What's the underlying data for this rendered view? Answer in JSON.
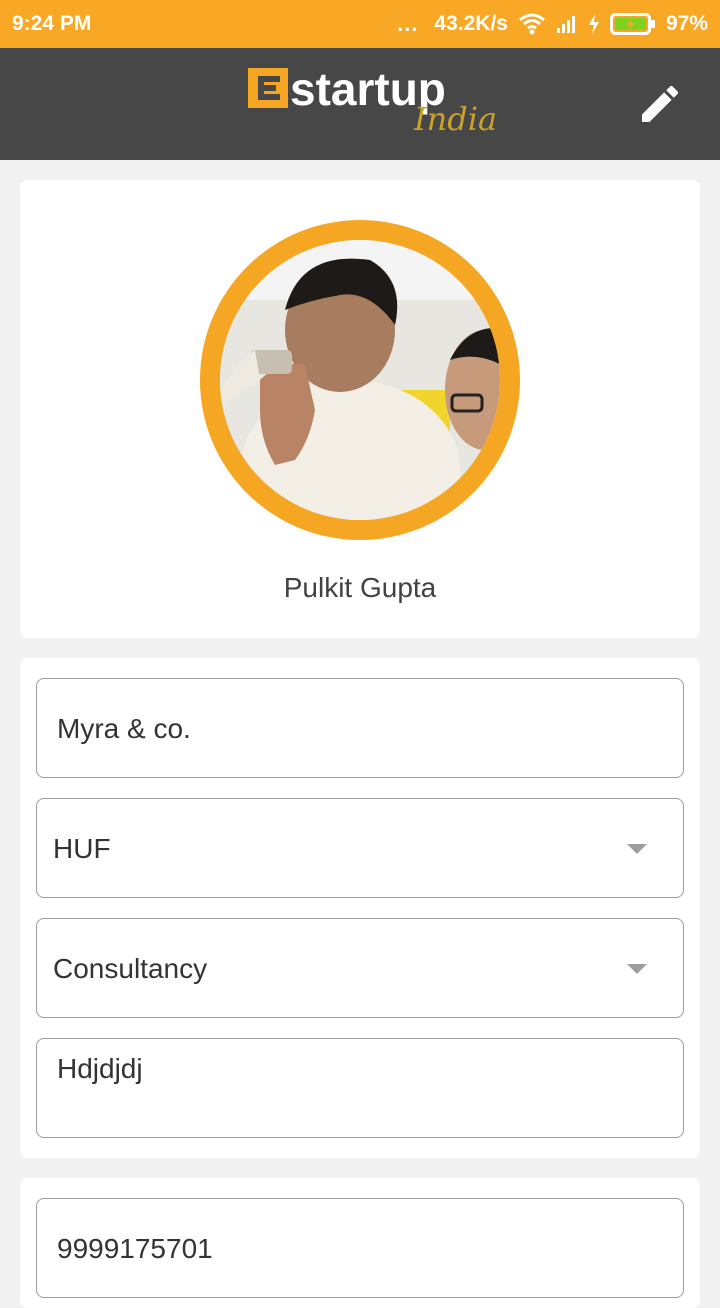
{
  "status_bar": {
    "time": "9:24 PM",
    "dots": "...",
    "speed": "43.2K/s",
    "battery": "97%",
    "accent_color": "#f9a825"
  },
  "app_bar": {
    "logo_text": "startup",
    "logo_sub": "India",
    "logo_mark": "E",
    "edit_icon": "pencil-icon",
    "background_color": "#474747"
  },
  "profile": {
    "name": "Pulkit Gupta",
    "avatar_ring_color": "#f5a623"
  },
  "form": {
    "company_name": "Myra  & co.",
    "entity_type": "HUF",
    "category": "Consultancy",
    "description": "Hdjdjdj",
    "phone": "9999175701"
  }
}
